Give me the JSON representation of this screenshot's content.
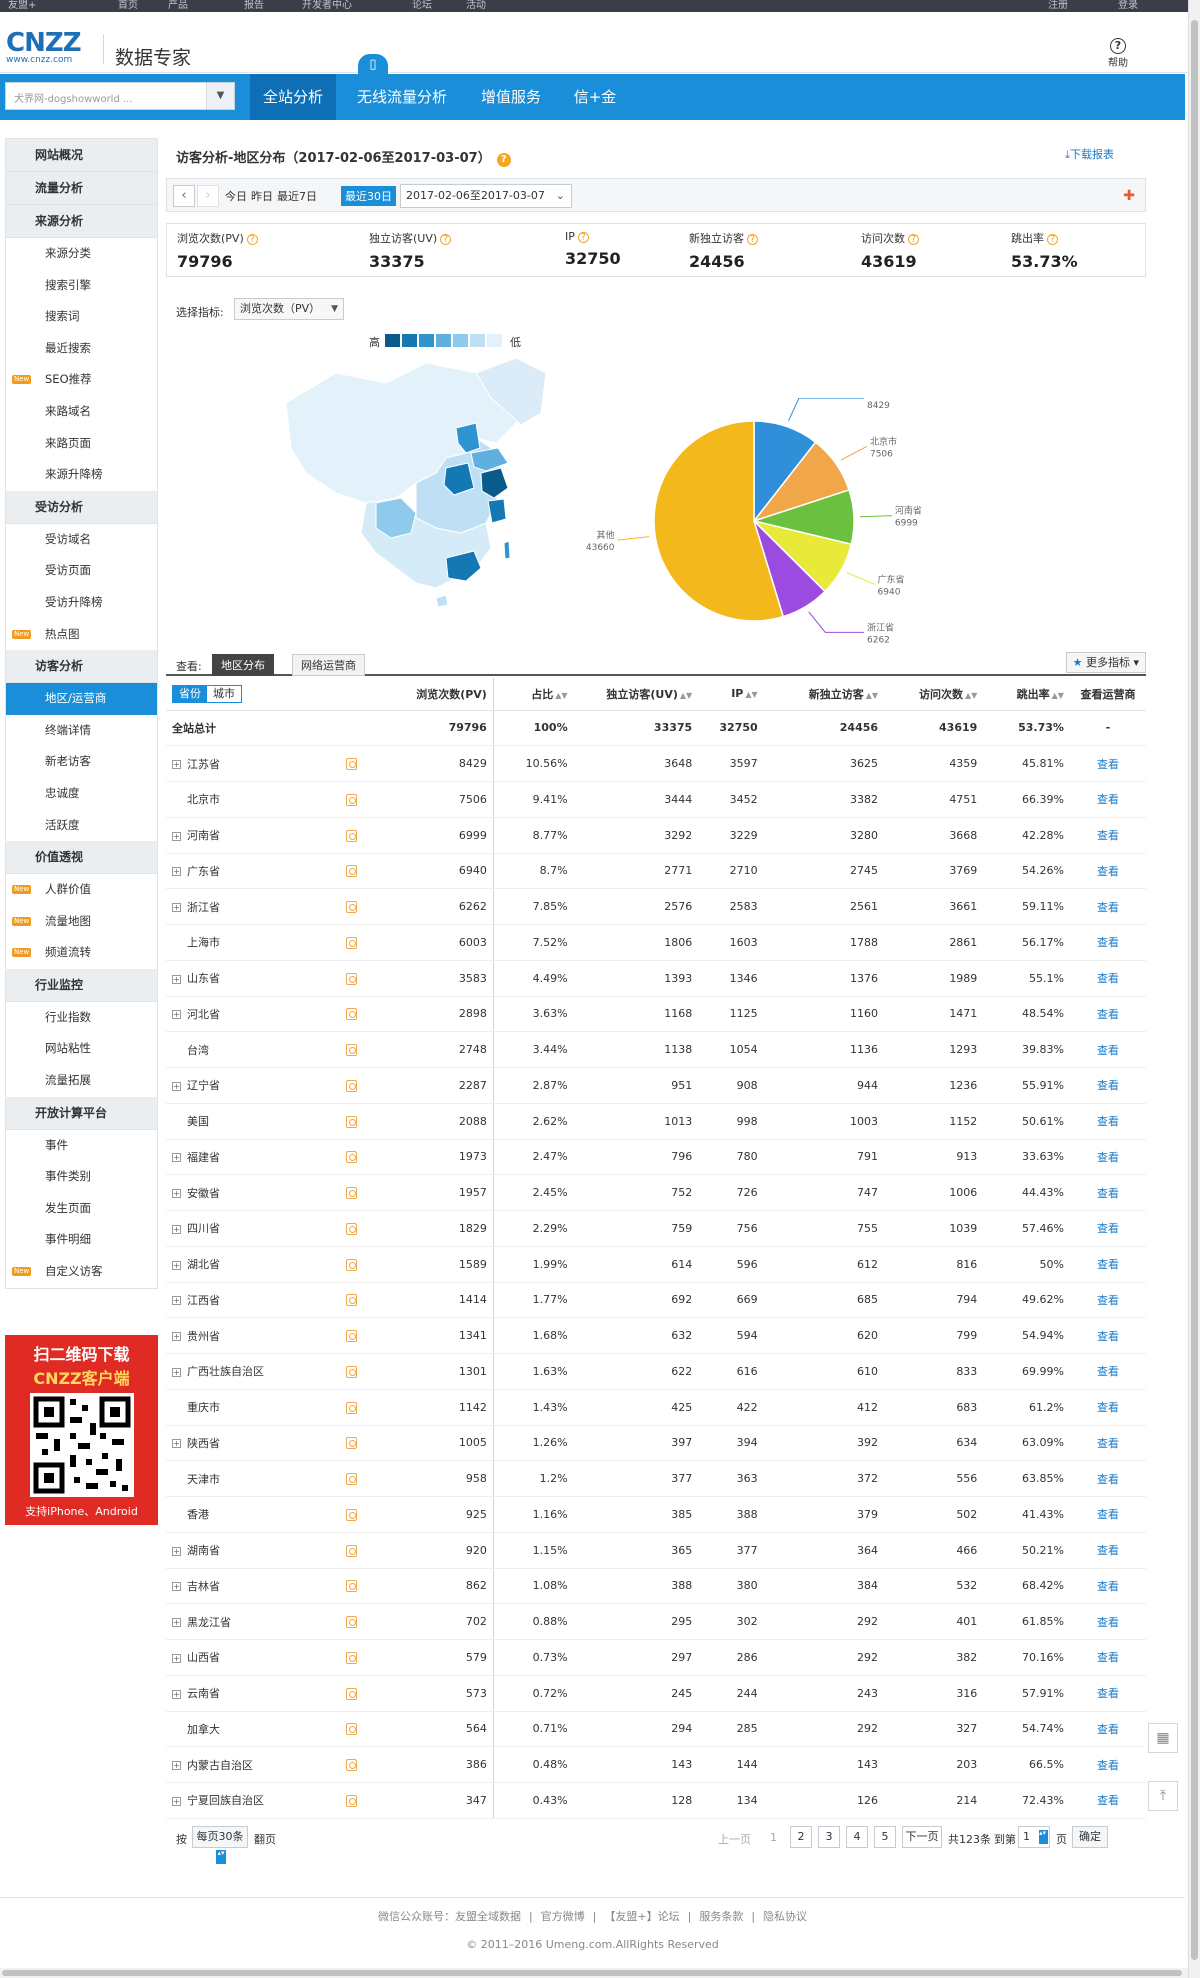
{
  "topbar": {
    "items": [
      "友盟+",
      "首页",
      "产品",
      "报告",
      "开发者中心",
      "论坛",
      "活动",
      "注册",
      "登录"
    ]
  },
  "header": {
    "logo_main": "CNZZ",
    "logo_sub": "www.cnzz.com",
    "brand": "数据专家",
    "help": "帮助",
    "help_icon": "?"
  },
  "nav": {
    "site_placeholder": "犬界网-dogshowworld ...",
    "tabs": [
      "全站分析",
      "无线流量分析",
      "增值服务",
      "信+金融"
    ]
  },
  "sidebar": {
    "sections": [
      {
        "head": "网站概况",
        "items": []
      },
      {
        "head": "流量分析",
        "items": []
      },
      {
        "head": "来源分析",
        "items": [
          {
            "label": "来源分类"
          },
          {
            "label": "搜索引擎"
          },
          {
            "label": "搜索词"
          },
          {
            "label": "最近搜索"
          },
          {
            "label": "SEO推荐",
            "new": true
          },
          {
            "label": "来路域名"
          },
          {
            "label": "来路页面"
          },
          {
            "label": "来源升降榜"
          }
        ]
      },
      {
        "head": "受访分析",
        "items": [
          {
            "label": "受访域名"
          },
          {
            "label": "受访页面"
          },
          {
            "label": "受访升降榜"
          },
          {
            "label": "热点图",
            "new": true
          }
        ]
      },
      {
        "head": "访客分析",
        "items": [
          {
            "label": "地区/运营商",
            "active": true
          },
          {
            "label": "终端详情"
          },
          {
            "label": "新老访客"
          },
          {
            "label": "忠诚度"
          },
          {
            "label": "活跃度"
          }
        ]
      },
      {
        "head": "价值透视",
        "items": [
          {
            "label": "人群价值",
            "new": true
          },
          {
            "label": "流量地图",
            "new": true
          },
          {
            "label": "频道流转",
            "new": true
          }
        ]
      },
      {
        "head": "行业监控",
        "items": [
          {
            "label": "行业指数"
          },
          {
            "label": "网站粘性"
          },
          {
            "label": "流量拓展"
          }
        ]
      },
      {
        "head": "开放计算平台",
        "items": [
          {
            "label": "事件"
          },
          {
            "label": "事件类别"
          },
          {
            "label": "发生页面"
          },
          {
            "label": "事件明细"
          },
          {
            "label": "自定义访客",
            "new": true
          }
        ]
      }
    ],
    "new_badge": "New",
    "ad": {
      "line1": "扫二维码下载",
      "line2": "CNZZ客户端",
      "line3": "支持iPhone、Android"
    }
  },
  "main": {
    "title": "访客分析-地区分布（2017-02-06至2017-03-07）",
    "download": "下载报表",
    "dates": {
      "today": "今日",
      "yesterday": "昨日",
      "last7": "最近7日",
      "last30": "最近30日",
      "range": "2017-02-06至2017-03-07"
    },
    "metrics": [
      {
        "label": "浏览次数(PV)",
        "value": "79796"
      },
      {
        "label": "独立访客(UV)",
        "value": "33375"
      },
      {
        "label": "IP",
        "value": "32750"
      },
      {
        "label": "新独立访客",
        "value": "24456"
      },
      {
        "label": "访问次数",
        "value": "43619"
      },
      {
        "label": "跳出率",
        "value": "53.73%"
      }
    ],
    "select_label": "选择指标:",
    "select_value": "浏览次数（PV）",
    "legend_high": "高",
    "legend_low": "低",
    "legend_colors": [
      "#0a5a8c",
      "#1478b4",
      "#2f95d0",
      "#5eb0e0",
      "#8fc9ec",
      "#bfe0f4",
      "#e3f1fa"
    ],
    "view_label": "查看:",
    "tabs": [
      "地区分布",
      "网络运营商"
    ],
    "more_metrics": "更多指标",
    "toggle": [
      "省份",
      "城市"
    ],
    "columns": [
      "浏览次数(PV)",
      "占比",
      "独立访客(UV)",
      "IP",
      "新独立访客",
      "访问次数",
      "跳出率",
      "查看运营商"
    ],
    "total": {
      "name": "全站总计",
      "pv": "79796",
      "share": "100%",
      "uv": "33375",
      "ip": "32750",
      "new_uv": "24456",
      "visits": "43619",
      "bounce": "53.73%",
      "view": "-"
    },
    "view_link": "查看",
    "rows": [
      {
        "name": "江苏省",
        "exp": true,
        "pv": "8429",
        "share": "10.56%",
        "uv": "3648",
        "ip": "3597",
        "new_uv": "3625",
        "visits": "4359",
        "bounce": "45.81%"
      },
      {
        "name": "北京市",
        "exp": false,
        "pv": "7506",
        "share": "9.41%",
        "uv": "3444",
        "ip": "3452",
        "new_uv": "3382",
        "visits": "4751",
        "bounce": "66.39%"
      },
      {
        "name": "河南省",
        "exp": true,
        "pv": "6999",
        "share": "8.77%",
        "uv": "3292",
        "ip": "3229",
        "new_uv": "3280",
        "visits": "3668",
        "bounce": "42.28%"
      },
      {
        "name": "广东省",
        "exp": true,
        "pv": "6940",
        "share": "8.7%",
        "uv": "2771",
        "ip": "2710",
        "new_uv": "2745",
        "visits": "3769",
        "bounce": "54.26%"
      },
      {
        "name": "浙江省",
        "exp": true,
        "pv": "6262",
        "share": "7.85%",
        "uv": "2576",
        "ip": "2583",
        "new_uv": "2561",
        "visits": "3661",
        "bounce": "59.11%"
      },
      {
        "name": "上海市",
        "exp": false,
        "pv": "6003",
        "share": "7.52%",
        "uv": "1806",
        "ip": "1603",
        "new_uv": "1788",
        "visits": "2861",
        "bounce": "56.17%"
      },
      {
        "name": "山东省",
        "exp": true,
        "pv": "3583",
        "share": "4.49%",
        "uv": "1393",
        "ip": "1346",
        "new_uv": "1376",
        "visits": "1989",
        "bounce": "55.1%"
      },
      {
        "name": "河北省",
        "exp": true,
        "pv": "2898",
        "share": "3.63%",
        "uv": "1168",
        "ip": "1125",
        "new_uv": "1160",
        "visits": "1471",
        "bounce": "48.54%"
      },
      {
        "name": "台湾",
        "exp": false,
        "pv": "2748",
        "share": "3.44%",
        "uv": "1138",
        "ip": "1054",
        "new_uv": "1136",
        "visits": "1293",
        "bounce": "39.83%"
      },
      {
        "name": "辽宁省",
        "exp": true,
        "pv": "2287",
        "share": "2.87%",
        "uv": "951",
        "ip": "908",
        "new_uv": "944",
        "visits": "1236",
        "bounce": "55.91%"
      },
      {
        "name": "美国",
        "exp": false,
        "pv": "2088",
        "share": "2.62%",
        "uv": "1013",
        "ip": "998",
        "new_uv": "1003",
        "visits": "1152",
        "bounce": "50.61%"
      },
      {
        "name": "福建省",
        "exp": true,
        "pv": "1973",
        "share": "2.47%",
        "uv": "796",
        "ip": "780",
        "new_uv": "791",
        "visits": "913",
        "bounce": "33.63%"
      },
      {
        "name": "安徽省",
        "exp": true,
        "pv": "1957",
        "share": "2.45%",
        "uv": "752",
        "ip": "726",
        "new_uv": "747",
        "visits": "1006",
        "bounce": "44.43%"
      },
      {
        "name": "四川省",
        "exp": true,
        "pv": "1829",
        "share": "2.29%",
        "uv": "759",
        "ip": "756",
        "new_uv": "755",
        "visits": "1039",
        "bounce": "57.46%"
      },
      {
        "name": "湖北省",
        "exp": true,
        "pv": "1589",
        "share": "1.99%",
        "uv": "614",
        "ip": "596",
        "new_uv": "612",
        "visits": "816",
        "bounce": "50%"
      },
      {
        "name": "江西省",
        "exp": true,
        "pv": "1414",
        "share": "1.77%",
        "uv": "692",
        "ip": "669",
        "new_uv": "685",
        "visits": "794",
        "bounce": "49.62%"
      },
      {
        "name": "贵州省",
        "exp": true,
        "pv": "1341",
        "share": "1.68%",
        "uv": "632",
        "ip": "594",
        "new_uv": "620",
        "visits": "799",
        "bounce": "54.94%"
      },
      {
        "name": "广西壮族自治区",
        "exp": true,
        "pv": "1301",
        "share": "1.63%",
        "uv": "622",
        "ip": "616",
        "new_uv": "610",
        "visits": "833",
        "bounce": "69.99%"
      },
      {
        "name": "重庆市",
        "exp": false,
        "pv": "1142",
        "share": "1.43%",
        "uv": "425",
        "ip": "422",
        "new_uv": "412",
        "visits": "683",
        "bounce": "61.2%"
      },
      {
        "name": "陕西省",
        "exp": true,
        "pv": "1005",
        "share": "1.26%",
        "uv": "397",
        "ip": "394",
        "new_uv": "392",
        "visits": "634",
        "bounce": "63.09%"
      },
      {
        "name": "天津市",
        "exp": false,
        "pv": "958",
        "share": "1.2%",
        "uv": "377",
        "ip": "363",
        "new_uv": "372",
        "visits": "556",
        "bounce": "63.85%"
      },
      {
        "name": "香港",
        "exp": false,
        "pv": "925",
        "share": "1.16%",
        "uv": "385",
        "ip": "388",
        "new_uv": "379",
        "visits": "502",
        "bounce": "41.43%"
      },
      {
        "name": "湖南省",
        "exp": true,
        "pv": "920",
        "share": "1.15%",
        "uv": "365",
        "ip": "377",
        "new_uv": "364",
        "visits": "466",
        "bounce": "50.21%"
      },
      {
        "name": "吉林省",
        "exp": true,
        "pv": "862",
        "share": "1.08%",
        "uv": "388",
        "ip": "380",
        "new_uv": "384",
        "visits": "532",
        "bounce": "68.42%"
      },
      {
        "name": "黑龙江省",
        "exp": true,
        "pv": "702",
        "share": "0.88%",
        "uv": "295",
        "ip": "302",
        "new_uv": "292",
        "visits": "401",
        "bounce": "61.85%"
      },
      {
        "name": "山西省",
        "exp": true,
        "pv": "579",
        "share": "0.73%",
        "uv": "297",
        "ip": "286",
        "new_uv": "292",
        "visits": "382",
        "bounce": "70.16%"
      },
      {
        "name": "云南省",
        "exp": true,
        "pv": "573",
        "share": "0.72%",
        "uv": "245",
        "ip": "244",
        "new_uv": "243",
        "visits": "316",
        "bounce": "57.91%"
      },
      {
        "name": "加拿大",
        "exp": false,
        "pv": "564",
        "share": "0.71%",
        "uv": "294",
        "ip": "285",
        "new_uv": "292",
        "visits": "327",
        "bounce": "54.74%"
      },
      {
        "name": "内蒙古自治区",
        "exp": true,
        "pv": "386",
        "share": "0.48%",
        "uv": "143",
        "ip": "144",
        "new_uv": "143",
        "visits": "203",
        "bounce": "66.5%"
      },
      {
        "name": "宁夏回族自治区",
        "exp": true,
        "pv": "347",
        "share": "0.43%",
        "uv": "128",
        "ip": "134",
        "new_uv": "126",
        "visits": "214",
        "bounce": "72.43%"
      }
    ],
    "pager": {
      "press": "按",
      "per_page": "每页30条",
      "turn": "翻页",
      "prev": "上一页",
      "pages": [
        "1",
        "2",
        "3",
        "4",
        "5"
      ],
      "next": "下一页",
      "total": "共123条",
      "goto": "到第",
      "goto_value": "1",
      "page_unit": "页",
      "confirm": "确定"
    }
  },
  "chart_data": {
    "type": "pie",
    "categories": [
      "江苏省",
      "北京市",
      "河南省",
      "广东省",
      "浙江省",
      "其他"
    ],
    "values": [
      8429,
      7506,
      6999,
      6940,
      6262,
      43660
    ],
    "colors": [
      "#2f8fd8",
      "#f2a64a",
      "#6cc040",
      "#e9e93a",
      "#9b4be0",
      "#f3b81b"
    ]
  },
  "footer": {
    "links": [
      "微信公众账号：友盟全域数据",
      "官方微博",
      "【友盟+】论坛",
      "服务条款",
      "隐私协议"
    ],
    "copyright": "© 2011–2016 Umeng.com.AllRights Reserved"
  }
}
